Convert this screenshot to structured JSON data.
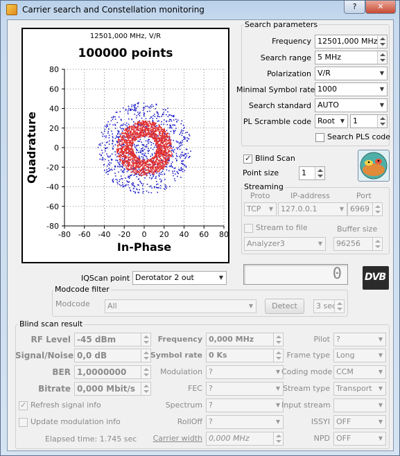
{
  "window": {
    "title": "Carrier search and Constellation monitoring",
    "help": "?",
    "close": "✕"
  },
  "chart_data": {
    "type": "scatter",
    "title": "100000 points",
    "subtitle": "12501,000 MHz, V/R",
    "xlabel": "In-Phase",
    "ylabel": "Quadrature",
    "xlim": [
      -80,
      80
    ],
    "ylim": [
      -80,
      80
    ],
    "xticks": [
      "-80",
      "-60",
      "-40",
      "-20",
      "0",
      "20",
      "40",
      "60",
      "80"
    ],
    "yticks": [
      "80",
      "60",
      "40",
      "20",
      "0",
      "-20",
      "-40",
      "-60",
      "-80"
    ],
    "grid": true,
    "series": [
      {
        "values": [
          {
            "r_inner": 12,
            "r_outer": 28
          }
        ],
        "color": "#e03030"
      },
      {
        "values": [
          {
            "r_inner": 0,
            "r_outer": 47
          }
        ],
        "color": "#1c1cc8"
      }
    ]
  },
  "search": {
    "group_title": "Search parameters",
    "frequency_label": "Frequency",
    "frequency": "12501,000 MHz",
    "range_label": "Search range",
    "range": "5 MHz",
    "polarization_label": "Polarization",
    "polarization": "V/R",
    "symrate_label": "Minimal Symbol rate",
    "symrate": "1000",
    "standard_label": "Search standard",
    "standard": "AUTO",
    "pls_label": "PL Scramble code",
    "pls_mode": "Root",
    "pls_value": "1",
    "search_pls_label": "Search PLS code"
  },
  "blind": {
    "label": "Blind Scan",
    "checked": true,
    "pointsize_label": "Point size",
    "pointsize": "1"
  },
  "streaming": {
    "title": "Streaming",
    "proto_label": "Proto",
    "ip_label": "IP-address",
    "port_label": "Port",
    "proto": "TCP",
    "ip": "127.0.0.1",
    "port": "6969",
    "stream_to_file": "Stream to file",
    "buffer_label": "Buffer size",
    "file": "Analyzer3",
    "buffer": "96256"
  },
  "counter": "0",
  "dvb_logo": "DVB",
  "iqscan": {
    "label": "IQScan point",
    "value": "Derotator 2 out"
  },
  "modcode": {
    "title": "Modcode filter",
    "label": "Modcode",
    "value": "All",
    "detect": "Detect",
    "interval": "3 sec"
  },
  "result": {
    "title": "Blind scan result",
    "rf_label": "RF Level",
    "rf": "-45 dBm",
    "sn_label": "Signal/Noise",
    "sn": "0,0 dB",
    "ber_label": "BER",
    "ber": "1,0000000",
    "bitrate_label": "Bitrate",
    "bitrate": "0,000 Mbit/s",
    "freq_label": "Frequency",
    "freq": "0,000 MHz",
    "sr_label": "Symbol rate",
    "sr": "0 Ks",
    "mod_label": "Modulation",
    "mod": "?",
    "fec_label": "FEC",
    "fec": "?",
    "spectrum_label": "Spectrum",
    "spectrum": "?",
    "rolloff_label": "RollOff",
    "rolloff": "?",
    "cw_label": "Carrier width",
    "cw": "0,000 MHz",
    "pilot_label": "Pilot",
    "pilot": "?",
    "frame_label": "Frame type",
    "frame": "Long",
    "coding_label": "Coding mode",
    "coding": "CCM",
    "stype_label": "Stream type",
    "stype": "Transport",
    "input_label": "Input stream",
    "input": "",
    "issyi_label": "ISSYI",
    "issyi": "OFF",
    "npd_label": "NPD",
    "npd": "OFF",
    "refresh_label": "Refresh signal info",
    "refresh_checked": true,
    "update_label": "Update modulation info",
    "update_checked": false,
    "elapsed": "Elapsed time: 1.745 sec"
  }
}
